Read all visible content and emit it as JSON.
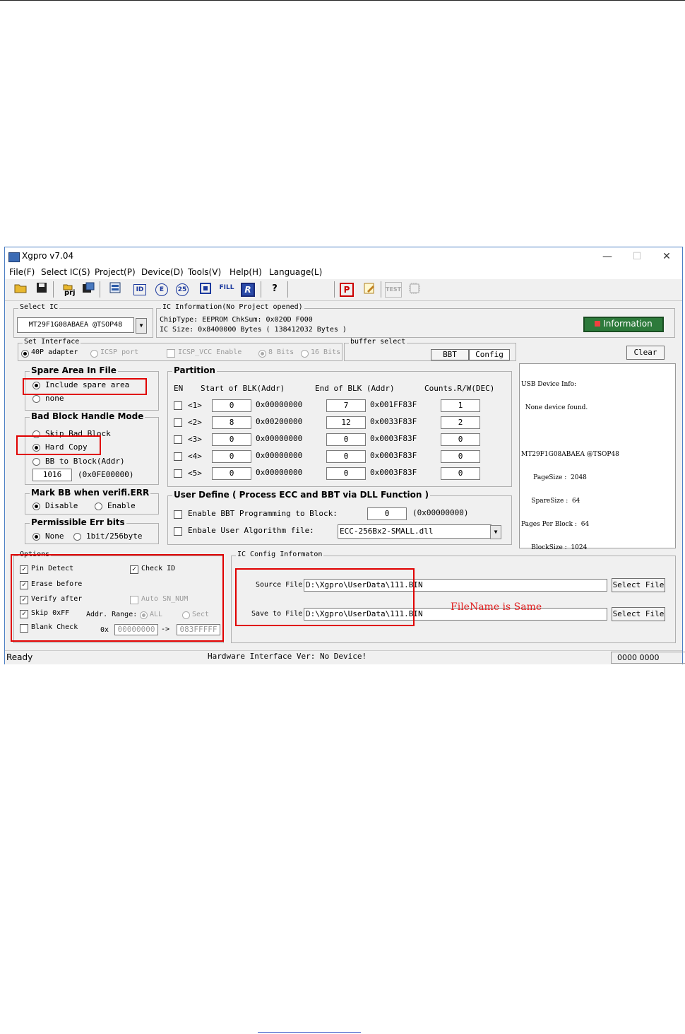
{
  "window": {
    "title": "Xgpro v7.04",
    "minimize": "—",
    "maximize": "☐",
    "close": "✕"
  },
  "menu": [
    "File(F)",
    "Select IC(S)",
    "Project(P)",
    "Device(D)",
    "Tools(V)",
    "Help(H)",
    "Language(L)"
  ],
  "toolbar": {
    "prj_label": "prj",
    "fill_label": "FILL",
    "help_label": "?",
    "test_label": "TEST",
    "p_label": "P",
    "r_label": "R",
    "id_label": "ID",
    "e_label": "E",
    "s_label": "25"
  },
  "select_ic": {
    "label": "Select IC",
    "value": "MT29F1G08ABAEA @TSOP48"
  },
  "ic_info": {
    "label": "IC Information(No Project opened)",
    "chip_type": "ChipType:  EEPROM     ChkSum:  0x020D F000",
    "ic_size": "IC Size:    0x8400000 Bytes ( 138412032 Bytes )",
    "information_button": "Information"
  },
  "interface": {
    "label": "Set Interface",
    "opt1": "40P adapter",
    "opt2": "ICSP port",
    "opt3": "ICSP_VCC Enable",
    "opt4": "8 Bits",
    "opt5": "16 Bits"
  },
  "buffer": {
    "label": "buffer select",
    "bbt": "BBT",
    "config": "Config"
  },
  "clear_button": "Clear",
  "usb_info": {
    "line1": "USB Device Info:",
    "line2": "  None device found.",
    "line3": "MT29F1G08ABAEA @TSOP48",
    "line4": "      PageSize :  2048",
    "line5": "     SpareSize :  64",
    "line6": "Pages Per Block :  64",
    "line7": "     BlockSize :  1024"
  },
  "spare": {
    "label": "Spare Area In File",
    "include": "Include spare area",
    "none": "none"
  },
  "bad_block": {
    "label": "Bad Block Handle Mode",
    "skip": "Skip Bad Block",
    "hard": "Hard Copy",
    "bb_to": "BB to Block(Addr)",
    "value": "1016",
    "addr": "(0x0FE00000)"
  },
  "partition": {
    "label": "Partition",
    "headers": {
      "en": "EN",
      "start": "Start of BLK(Addr)",
      "end": "End of BLK (Addr)",
      "counts": "Counts.R/W(DEC)"
    },
    "rows": [
      {
        "id": "<1>",
        "start": "0",
        "start_addr": "0x00000000",
        "end": "7",
        "end_addr": "0x001FF83F",
        "count": "1"
      },
      {
        "id": "<2>",
        "start": "8",
        "start_addr": "0x00200000",
        "end": "12",
        "end_addr": "0x0033F83F",
        "count": "2"
      },
      {
        "id": "<3>",
        "start": "0",
        "start_addr": "0x00000000",
        "end": "0",
        "end_addr": "0x0003F83F",
        "count": "0"
      },
      {
        "id": "<4>",
        "start": "0",
        "start_addr": "0x00000000",
        "end": "0",
        "end_addr": "0x0003F83F",
        "count": "0"
      },
      {
        "id": "<5>",
        "start": "0",
        "start_addr": "0x00000000",
        "end": "0",
        "end_addr": "0x0003F83F",
        "count": "0"
      }
    ]
  },
  "mark_bb": {
    "label": "Mark BB when verifi.ERR",
    "disable": "Disable",
    "enable": "Enable"
  },
  "err_bits": {
    "label": "Permissible Err bits",
    "none": "None",
    "opt": "1bit/256byte"
  },
  "user_define": {
    "label": "User Define ( Process ECC and BBT via DLL Function )",
    "bbt_label": "Enable BBT Programming to Block:",
    "bbt_value": "0",
    "bbt_addr": "(0x00000000)",
    "algo_label": "Enbale User Algorithm file:",
    "algo_value": "ECC-256Bx2-SMALL.dll"
  },
  "options": {
    "label": "Options",
    "pin_detect": "Pin Detect",
    "check_id": "Check ID",
    "erase_before": "Erase before",
    "verify_after": "Verify after",
    "auto_sn": "Auto SN_NUM",
    "skip_ff": "Skip 0xFF",
    "addr_range": "Addr. Range:",
    "all": "ALL",
    "sect": "Sect",
    "blank_check": "Blank Check",
    "ox": "0x",
    "from": "00000000",
    "arrow": "->",
    "to": "083FFFFF"
  },
  "ic_config": {
    "label": "IC Config Informaton",
    "source_label": "Source File",
    "source_value": "D:\\Xgpro\\UserData\\111.BIN",
    "save_label": "Save to File",
    "save_value": "D:\\Xgpro\\UserData\\111.BIN",
    "select_file": "Select File",
    "annotation": "FileName is Same"
  },
  "status": {
    "ready": "Ready",
    "hw": "Hardware Interface Ver: No Device!",
    "code": "0000 0000"
  }
}
